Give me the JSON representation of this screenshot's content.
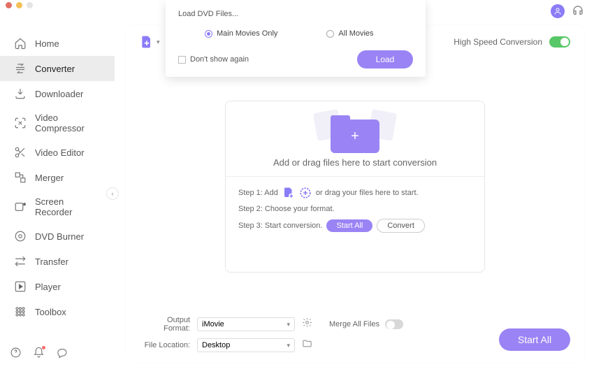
{
  "titlebar": {
    "dots": [
      "#e26f64",
      "#f3bf55",
      "#e4e4e4"
    ]
  },
  "header_icons": {
    "avatar": "user",
    "support": "headset"
  },
  "sidebar": {
    "items": [
      {
        "label": "Home",
        "icon": "home"
      },
      {
        "label": "Converter",
        "icon": "converter",
        "active": true
      },
      {
        "label": "Downloader",
        "icon": "download"
      },
      {
        "label": "Video Compressor",
        "icon": "compress"
      },
      {
        "label": "Video Editor",
        "icon": "scissors"
      },
      {
        "label": "Merger",
        "icon": "merge"
      },
      {
        "label": "Screen Recorder",
        "icon": "record"
      },
      {
        "label": "DVD Burner",
        "icon": "disc"
      },
      {
        "label": "Transfer",
        "icon": "transfer"
      },
      {
        "label": "Player",
        "icon": "play"
      },
      {
        "label": "Toolbox",
        "icon": "grid"
      }
    ],
    "bottom": [
      "help",
      "bell",
      "chat"
    ]
  },
  "toolbar": {
    "high_speed_label": "High Speed Conversion",
    "high_speed_on": true
  },
  "dropzone": {
    "main_text": "Add or drag files here to start conversion",
    "step1_prefix": "Step 1: Add",
    "step1_suffix": "or drag your files here to start.",
    "step2": "Step 2: Choose your format.",
    "step3": "Step 3: Start conversion.",
    "btn_startall": "Start  All",
    "btn_convert": "Convert"
  },
  "bottom": {
    "output_format_label": "Output Format:",
    "output_format_value": "iMovie",
    "file_location_label": "File Location:",
    "file_location_value": "Desktop",
    "merge_label": "Merge All Files",
    "merge_on": false,
    "start_all": "Start All"
  },
  "modal": {
    "title": "Load DVD Files...",
    "opt_main": "Main Movies Only",
    "opt_all": "All Movies",
    "selected": "main",
    "dont_show": "Don't show again",
    "load": "Load"
  },
  "colors": {
    "accent": "#9a83f4",
    "green": "#58c768"
  }
}
